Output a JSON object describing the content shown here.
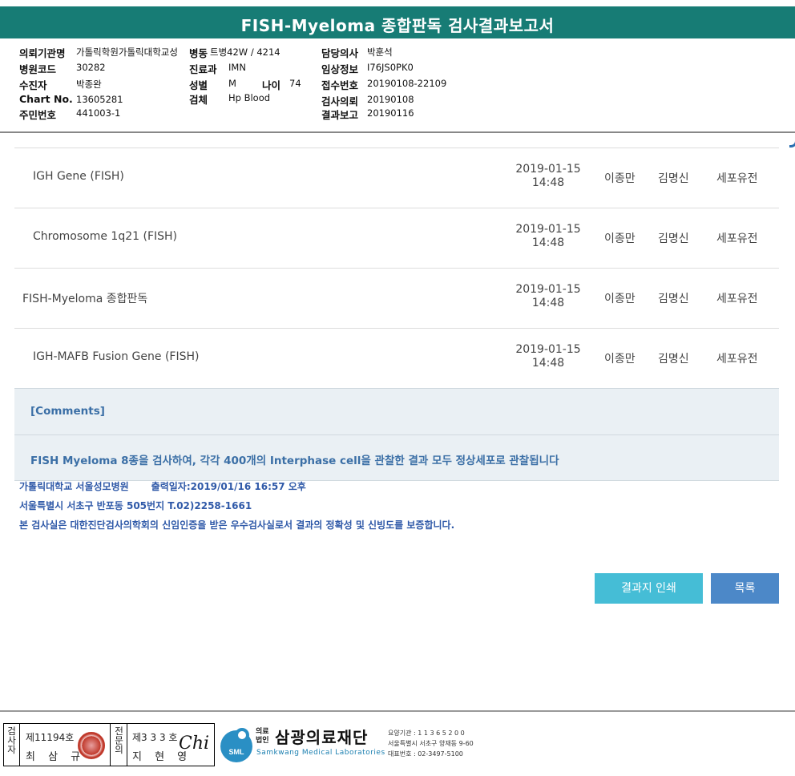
{
  "header": {
    "title": "FISH-Myeloma 종합판독 검사결과보고서"
  },
  "patient_info": {
    "institution_label": "의뢰기관명",
    "institution": "가톨릭학원가톨릭대학교성",
    "ward_label": "병동",
    "ward": "트병42W / 4214",
    "doctor_label": "담당의사",
    "doctor": "박훈석",
    "hospital_code_label": "병원코드",
    "hospital_code": "30282",
    "department_label": "진료과",
    "department": "IMN",
    "clinical_info_label": "임상정보",
    "clinical_info": "I76JS0PK0",
    "patient_label": "수진자",
    "patient": "박종완",
    "sex_label": "성별",
    "sex": "M",
    "age_label": "나이",
    "age": "74",
    "reception_label": "접수번호",
    "reception": "20190108-22109",
    "chart_label": "Chart No.",
    "chart": "13605281",
    "specimen_label": "검체",
    "specimen": "Hp Blood",
    "request_label": "검사의뢰",
    "request_date": "20190108",
    "rrn_label": "주민번호",
    "rrn": "441003-1",
    "report_label": "결과보고",
    "report_date": "20190116"
  },
  "results": [
    {
      "name": "IGH Gene (FISH)",
      "date": "2019-01-15",
      "time": "14:48",
      "person1": "이종만",
      "person2": "김명신",
      "dept": "세포유전",
      "indent": true
    },
    {
      "name": "Chromosome 1q21 (FISH)",
      "date": "2019-01-15",
      "time": "14:48",
      "person1": "이종만",
      "person2": "김명신",
      "dept": "세포유전",
      "indent": true
    },
    {
      "name": "FISH-Myeloma 종합판독",
      "date": "2019-01-15",
      "time": "14:48",
      "person1": "이종만",
      "person2": "김명신",
      "dept": "세포유전",
      "indent": false
    },
    {
      "name": "IGH-MAFB Fusion Gene (FISH)",
      "date": "2019-01-15",
      "time": "14:48",
      "person1": "이종만",
      "person2": "김명신",
      "dept": "세포유전",
      "indent": true
    }
  ],
  "comments": {
    "heading": "[Comments]",
    "text": "FISH Myeloma 8종을 검사하여, 각각 400개의 Interphase cell을 관찰한 결과 모두 정상세포로 관찰됩니다"
  },
  "footer": {
    "hospital": "가톨릭대학교 서울성모병원",
    "printed": "출력일자:2019/01/16 16:57 오후",
    "address": "서울특별시 서초구 반포동 505번지 T.02)2258-1661",
    "certification": "본 검사실은 대한진단검사의학회의 신임인증을 받은 우수검사실로서 결과의 정확성 및 신빙도를 보증합니다."
  },
  "buttons": {
    "print": "결과지 인쇄",
    "list": "목록"
  },
  "stamp": {
    "examiner_label": "검사자",
    "examiner_no": "제11194호",
    "examiner_name": "최 삼 규",
    "specialist_label": "전문의",
    "specialist_no": "제3 3 3 호",
    "specialist_name": "지 현 영",
    "signature": "Chi"
  },
  "org": {
    "small1": "의료",
    "small2": "법인",
    "name": "삼광의료재단",
    "english": "Samkwang Medical Laboratories",
    "logo_text": "SML",
    "info1": "요양기관 : 1 1 3 6 5 2 0 0",
    "info2": "서울특별시 서초구 양재동 9-60",
    "info3": "대표번호 : 02-3497-5100"
  },
  "colors": {
    "header_bg": "#177c75",
    "accent_blue": "#3b6fa6",
    "print_btn": "#45bdd6",
    "list_btn": "#4c88c8"
  }
}
